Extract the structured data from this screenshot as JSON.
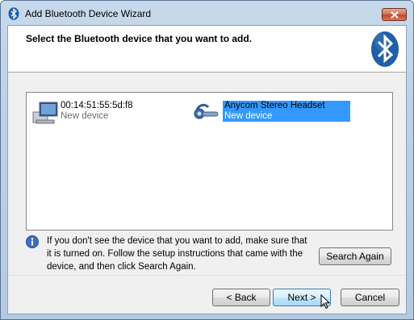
{
  "window": {
    "title": "Add Bluetooth Device Wizard",
    "icon": "bluetooth-icon"
  },
  "header": {
    "instruction": "Select the Bluetooth device that you want to add."
  },
  "devices": [
    {
      "name": "00:14:51:55:5d:f8",
      "status": "New device",
      "icon": "computer-icon",
      "selected": false
    },
    {
      "name": "Anycom Stereo Headset",
      "status": "New device",
      "icon": "headset-icon",
      "selected": true
    }
  ],
  "info": {
    "text": "If you don't see the device that you want to add, make sure that it is turned on. Follow the setup instructions that came with the device, and then click Search Again.",
    "icon": "info-icon"
  },
  "buttons": {
    "search_again": "Search Again",
    "back": "< Back",
    "next": "Next >",
    "cancel": "Cancel"
  },
  "colors": {
    "selection": "#3399ff",
    "bluetooth_brand": "#1f5fa8"
  }
}
